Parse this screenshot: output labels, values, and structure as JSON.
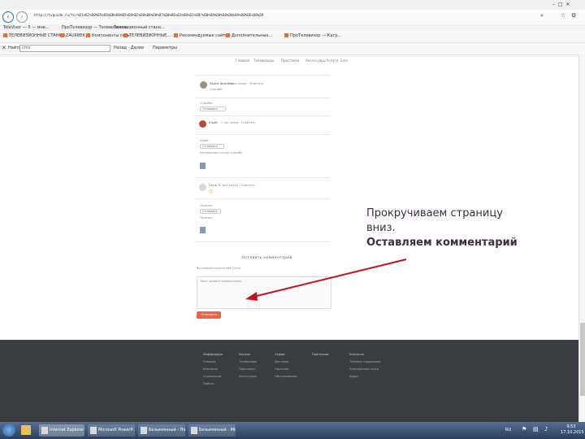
{
  "browser": {
    "tabs": [
      {
        "label": "TeleVisor — 5 — мне..."
      },
      {
        "label": "ПроТелевизор — Телевизионн..."
      },
      {
        "label": "Телевизионный стано..."
      }
    ],
    "url": "http://tvguide.ru/tv/%D1%82%D0%B5%D0%BB%D0%B5%D0%B2%D0%B8%D0%B7%D0%BE%D1%80%D1%8B/%D0%BA%D0%B0%D0%BA%D0%BE%D0%B9",
    "favorites": [
      {
        "label": "ТЕЛЕВИЗИОННЫЕ СТАНКИ..."
      },
      {
        "label": "ZAURBEK"
      },
      {
        "label": "Компоненты сель"
      },
      {
        "label": "ТЕЛЕВИЗИОННЫЕ..."
      },
      {
        "label": "Рекомендуемые сайты"
      },
      {
        "label": "Дополнительные..."
      },
      {
        "label": "ПроТелевизор — Катр..."
      }
    ],
    "find_label": "Найти:",
    "find_value": "cms",
    "find_prev_next": "Назад · Далее",
    "options_label": "Параметры"
  },
  "page": {
    "menu": [
      "Главная",
      "Телевизоры",
      "Приставки",
      "Аксессуары",
      "Услуги",
      "Блог"
    ],
    "comments": [
      {
        "author": "Ирина Шмелёва",
        "meta": "2 часа назад · Ответить",
        "text": "Спасибо"
      },
      {
        "author": "Юрий",
        "meta": "1 час назад · Ответить",
        "text": "Интересная статья, спасибо"
      },
      {
        "author": "Гость",
        "meta": "30 мин назад · Ответить",
        "text": "Полезно"
      }
    ],
    "leave_comment_heading": "Оставить комментарий",
    "author_line": "Вы комментируете как Гость",
    "comment_placeholder": "Текст вашего комментария",
    "submit_label": "Отправить",
    "footer_cols": [
      {
        "title": "Информация",
        "items": [
          "Главная",
          "Контакты",
          "О компании",
          "Пресса"
        ]
      },
      {
        "title": "Каталог",
        "items": [
          "Телевизоры",
          "Приставки",
          "Аксессуары"
        ]
      },
      {
        "title": "Сервис",
        "items": [
          "Доставка",
          "Гарантия",
          "Обслуживание"
        ]
      },
      {
        "title": "Партнерам",
        "items": []
      },
      {
        "title": "Контакты",
        "items": [
          "Телефон поддержки",
          "Электронная почта",
          "Адрес"
        ]
      }
    ]
  },
  "annotation": {
    "line1": "Прокручиваем страницу",
    "line2": "вниз.",
    "line3": "Оставляем комментарий",
    "color": "#c1121f"
  },
  "taskbar": {
    "items": [
      {
        "label": "Internet Explorer"
      },
      {
        "label": "Microsoft PowerP..."
      },
      {
        "label": "Безымянный - Пэи..."
      },
      {
        "label": "Безымянный - Micr..."
      }
    ],
    "lang": "RU",
    "time": "9:53",
    "date": "17.10.2015"
  }
}
